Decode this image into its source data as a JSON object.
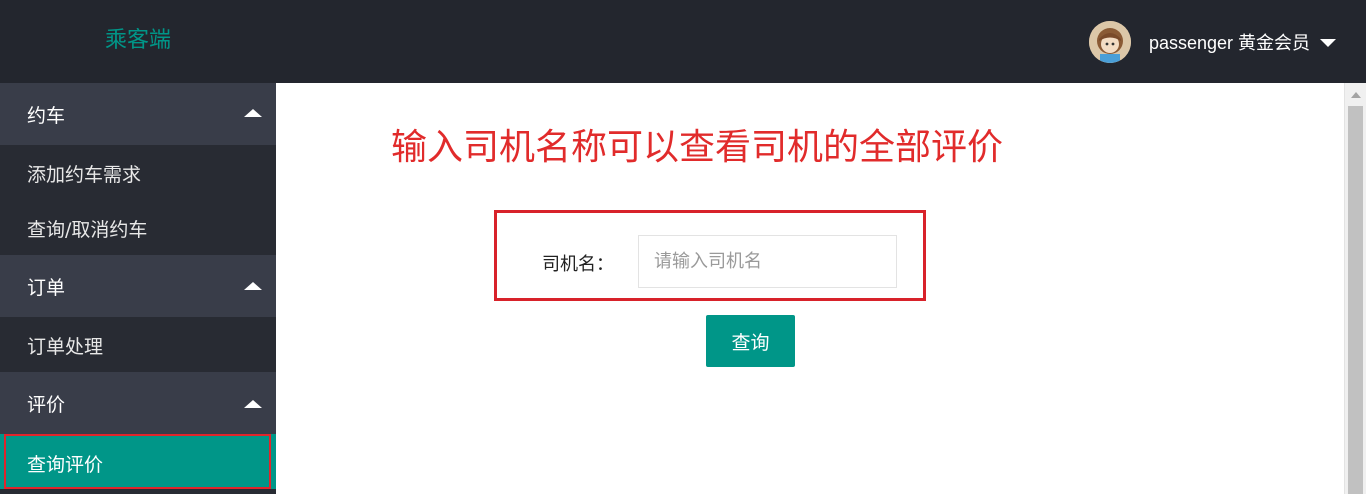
{
  "header": {
    "brand": "乘客端",
    "user_label": "passenger 黄金会员"
  },
  "sidebar": {
    "groups": [
      {
        "label": "约车",
        "items": [
          {
            "label": "添加约车需求"
          },
          {
            "label": "查询/取消约车"
          }
        ]
      },
      {
        "label": "订单",
        "items": [
          {
            "label": "订单处理"
          }
        ]
      },
      {
        "label": "评价",
        "items": [
          {
            "label": "查询评价",
            "active": true
          }
        ]
      }
    ]
  },
  "main": {
    "headline": "输入司机名称可以查看司机的全部评价",
    "form": {
      "driver_label": "司机名：",
      "driver_placeholder": "请输入司机名",
      "driver_value": "",
      "submit_label": "查询"
    }
  },
  "colors": {
    "topbar_bg": "#23262e",
    "accent": "#009688",
    "annotation_red": "#e12b2b"
  }
}
